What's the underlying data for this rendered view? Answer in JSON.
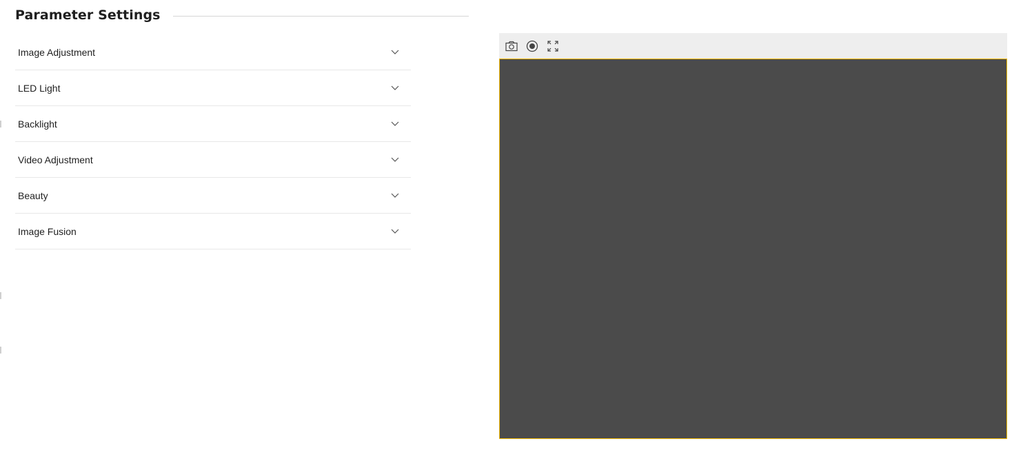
{
  "header": {
    "title": "Parameter Settings"
  },
  "settings": {
    "items": [
      {
        "label": "Image Adjustment"
      },
      {
        "label": "LED Light"
      },
      {
        "label": "Backlight"
      },
      {
        "label": "Video Adjustment"
      },
      {
        "label": "Beauty"
      },
      {
        "label": "Image Fusion"
      }
    ]
  },
  "video": {
    "toolbar": {
      "icons": [
        "camera-icon",
        "record-icon",
        "fullscreen-icon"
      ]
    }
  },
  "colors": {
    "video_background": "#4b4b4b",
    "video_border_accent": "#f2b800",
    "toolbar_background": "#eeeeee",
    "divider": "#e8e8e8"
  }
}
